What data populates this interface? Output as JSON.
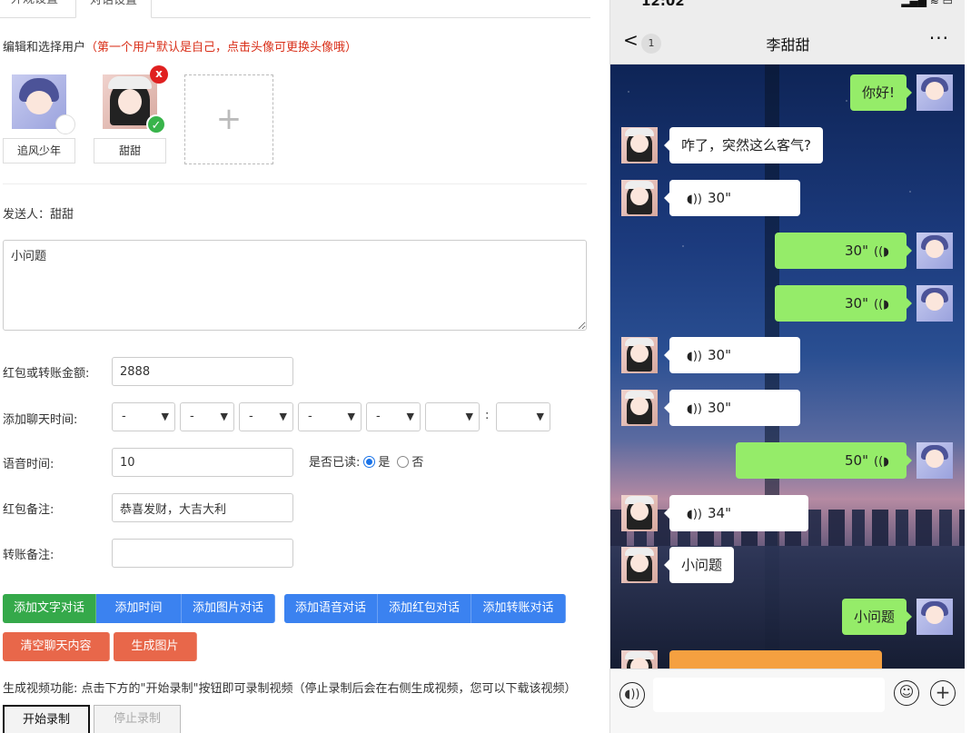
{
  "tabs": [
    "外观设置",
    "对话设置"
  ],
  "hint": {
    "main": "编辑和选择用户",
    "note": "（第一个用户默认是自己，点击头像可更换头像哦）"
  },
  "users": [
    {
      "name": "追风少年"
    },
    {
      "name": "甜甜"
    }
  ],
  "add_user": "+",
  "delete_mark": "x",
  "check_mark": "✓",
  "sender": "发送人：甜甜",
  "message_text": "小问题",
  "form": {
    "amount_label": "红包或转账金额:",
    "amount_value": "2888",
    "time_label": "添加聊天时间:",
    "time_selects": [
      "-",
      "-",
      "-",
      "-",
      "-",
      "",
      ""
    ],
    "time_colon": ":",
    "voice_label": "语音时间:",
    "voice_value": "10",
    "read_label": "是否已读:",
    "read_yes": "是",
    "read_no": "否",
    "redpacket_note_label": "红包备注:",
    "redpacket_note_value": "恭喜发财，大吉大利",
    "transfer_note_label": "转账备注:",
    "transfer_note_value": ""
  },
  "buttons": {
    "add_text": "添加文字对话",
    "add_time": "添加时间",
    "add_image": "添加图片对话",
    "add_voice": "添加语音对话",
    "add_redpacket": "添加红包对话",
    "add_transfer": "添加转账对话",
    "clear": "清空聊天内容",
    "gen_image": "生成图片",
    "start_rec": "开始录制",
    "stop_rec": "停止录制"
  },
  "video_note": "生成视频功能: 点击下方的\"开始录制\"按钮即可录制视频（停止录制后会在右侧生成视频，您可以下载该视频）",
  "colors": {
    "green": "#35a94a",
    "blue": "#3b82f0",
    "orange": "#e8674a",
    "wechat_green": "#95ec69"
  },
  "phone": {
    "time": "12:02",
    "status_icons": "▂▄▆ ≋ ▭",
    "back_icon": "<",
    "unread": "1",
    "chat_title": "李甜甜",
    "more_icon": "···",
    "messages": [
      {
        "from": "me",
        "text": "你好!"
      },
      {
        "from": "her",
        "text": "咋了，突然这么客气?"
      },
      {
        "from": "her",
        "text": "30\""
      },
      {
        "from": "me",
        "text": "30\""
      },
      {
        "from": "me",
        "text": "30\""
      },
      {
        "from": "her",
        "text": "30\""
      },
      {
        "from": "her",
        "text": "30\""
      },
      {
        "from": "me",
        "text": "50\""
      },
      {
        "from": "her",
        "text": "34\""
      },
      {
        "from": "her",
        "text": "小问题"
      },
      {
        "from": "me",
        "text": "小问题"
      }
    ],
    "voice_icon_her": "◖))",
    "voice_icon_me": "((◗"
  }
}
